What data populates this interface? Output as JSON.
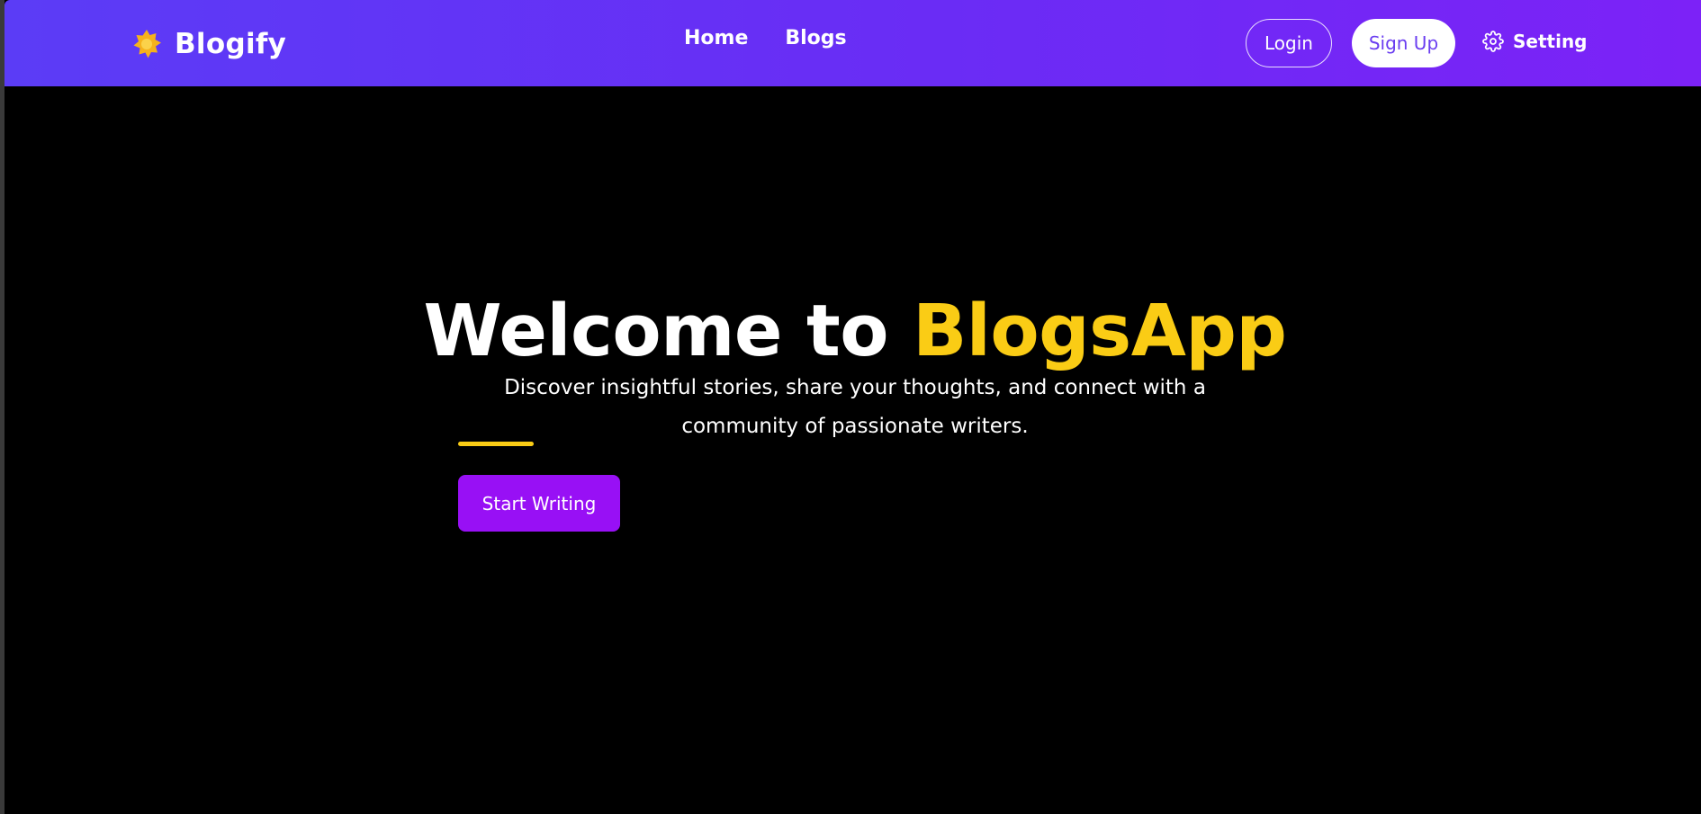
{
  "brand": {
    "name": "Blogify",
    "icon": "star-badge-icon"
  },
  "nav": {
    "links": [
      {
        "label": "Home"
      },
      {
        "label": "Blogs"
      }
    ]
  },
  "auth": {
    "login_label": "Login",
    "signup_label": "Sign Up"
  },
  "settings": {
    "label": "Setting",
    "icon": "gear-icon"
  },
  "hero": {
    "title_prefix": "Welcome to ",
    "title_accent": "BlogsApp",
    "subtitle": "Discover insightful stories, share your thoughts, and connect with a community of passionate writers.",
    "cta_label": "Start Writing"
  },
  "colors": {
    "nav_gradient_start": "#5b3cf6",
    "nav_gradient_end": "#7c22f7",
    "accent_yellow": "#facc15",
    "cta_purple": "#9810f5",
    "background": "#000000"
  }
}
